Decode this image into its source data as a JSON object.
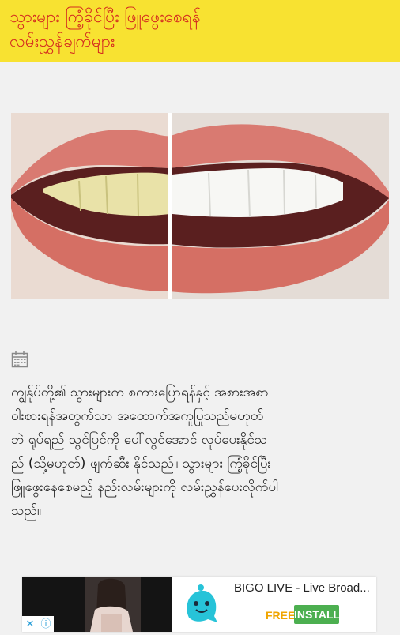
{
  "header": {
    "title_line1": "သွားများ ကြံ့ခိုင်ပြီး ဖြူဖွေးစေရန်",
    "title_line2": "လမ်းညွှန်ချက်များ"
  },
  "article": {
    "line1": "ကျွန်ုပ်တို့၏ သွားများက စကားပြောရန်နှင့်  အစားအစာ",
    "line2": "ဝါးစားရန်အတွက်သာ အထောက်အကူပြုသည်မဟုတ်",
    "line3": "ဘဲ ရုပ်ရည် သွင်ပြင်ကို ပေါ်လွင်အောင် လုပ်ပေးနိုင်သ",
    "line4": "ည် (သို့မဟုတ်) ဖျက်ဆီး နိုင်သည်။ သွားများ ကြံ့ခိုင်ပြီး",
    "line5": "ဖြူဖွေးနေစေမည့် နည်းလမ်းများကို လမ်းညွှန်ပေးလိုက်ပါ",
    "line6": "သည်။"
  },
  "ad": {
    "title": "BIGO LIVE - Live Broad...",
    "price": "FREE",
    "install_label": "INSTALL",
    "close_glyph": "✕",
    "info_glyph": "ⓘ"
  },
  "colors": {
    "header_bg": "#f8e231",
    "header_text": "#d42a1f",
    "install_bg": "#4caf50",
    "free_text": "#f0a500"
  },
  "icons": [
    "calendar-icon",
    "bigo-logo-icon",
    "close-icon",
    "info-icon"
  ]
}
